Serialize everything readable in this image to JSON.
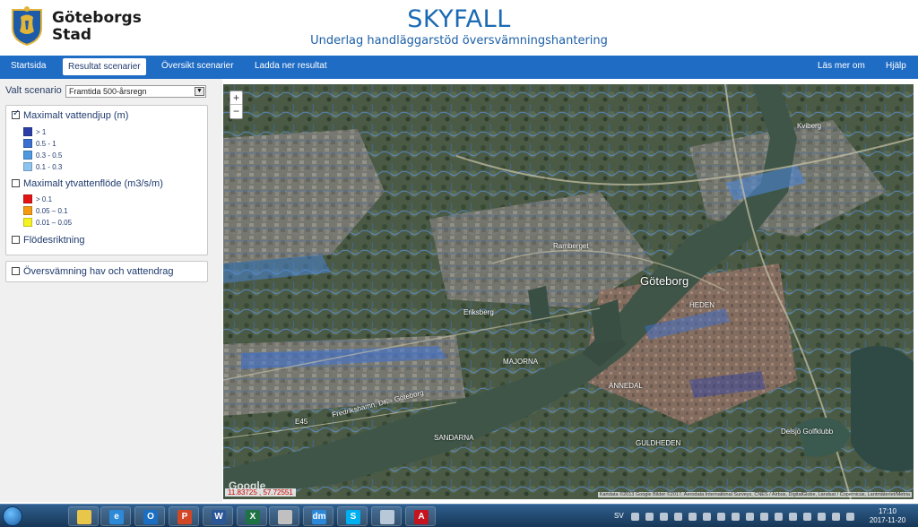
{
  "header": {
    "logo_line1": "Göteborgs",
    "logo_line2": "Stad",
    "title": "SKYFALL",
    "subtitle": "Underlag handläggarstöd översvämningshantering"
  },
  "nav": {
    "items": [
      "Startsida",
      "Resultat scenarier",
      "Översikt scenarier",
      "Ladda ner resultat"
    ],
    "active": "Resultat scenarier",
    "right": [
      "Läs mer om",
      "Hjälp"
    ]
  },
  "sidebar": {
    "scenario_label": "Valt scenario",
    "scenario_value": "Framtida 500-årsregn",
    "layers": [
      {
        "label": "Maximalt vattendjup (m)",
        "checked": true,
        "legend": [
          {
            "label": "> 1",
            "color": "#2b3ea8"
          },
          {
            "label": "0.5 - 1",
            "color": "#3b6fd0"
          },
          {
            "label": "0.3 - 0.5",
            "color": "#4f97de"
          },
          {
            "label": "0.1 - 0.3",
            "color": "#8ec3ee"
          }
        ]
      },
      {
        "label": "Maximalt ytvattenflöde (m3/s/m)",
        "checked": false,
        "legend": [
          {
            "label": "> 0.1",
            "color": "#e31414"
          },
          {
            "label": "0.05 – 0.1",
            "color": "#f29b12"
          },
          {
            "label": "0.01 – 0.05",
            "color": "#f5f222"
          }
        ]
      },
      {
        "label": "Flödesriktning",
        "checked": false
      }
    ],
    "panel2_label": "Översvämning hav och vattendrag",
    "panel2_checked": false
  },
  "map": {
    "zoom_in": "+",
    "zoom_out": "−",
    "coords": "11.83725 , 57.72551",
    "attribution": "Kartdata ©2013 Google Bilder ©2017, Aerodata International Surveys, CNES / Airbus, DigitalGlobe, Landsat / Copernicus, Lantmäteriet/Metria",
    "google": "Google",
    "labels": [
      "Kviberg",
      "Göteborg",
      "Ramberget",
      "Eriksberg",
      "HEDEN",
      "ANNEDAL",
      "MAJORNA",
      "SANDARNA",
      "GULDHEDEN",
      "Delsjö Golfklubb",
      "Fredrikshamn, DK - Göteborg",
      "E45"
    ]
  },
  "taskbar": {
    "apps": [
      {
        "name": "explorer-app",
        "color": "#e8c64a",
        "glyph": ""
      },
      {
        "name": "internet-explorer-app",
        "color": "#2d8ad8",
        "glyph": "e"
      },
      {
        "name": "outlook-app",
        "color": "#1a6fc2",
        "glyph": "O"
      },
      {
        "name": "powerpoint-app",
        "color": "#d24726",
        "glyph": "P"
      },
      {
        "name": "word-app",
        "color": "#2b5797",
        "glyph": "W"
      },
      {
        "name": "excel-app",
        "color": "#1f7244",
        "glyph": "X"
      },
      {
        "name": "snipping-app",
        "color": "#c0c0c0",
        "glyph": ""
      },
      {
        "name": "dm-app",
        "color": "#2c88d9",
        "glyph": "dm"
      },
      {
        "name": "skype-app",
        "color": "#00aff0",
        "glyph": "S"
      },
      {
        "name": "notepad-app",
        "color": "#b8c8d8",
        "glyph": ""
      },
      {
        "name": "acrobat-app",
        "color": "#c5141d",
        "glyph": "A"
      }
    ],
    "lang": "SV",
    "time": "17:10",
    "date": "2017-11-20"
  }
}
